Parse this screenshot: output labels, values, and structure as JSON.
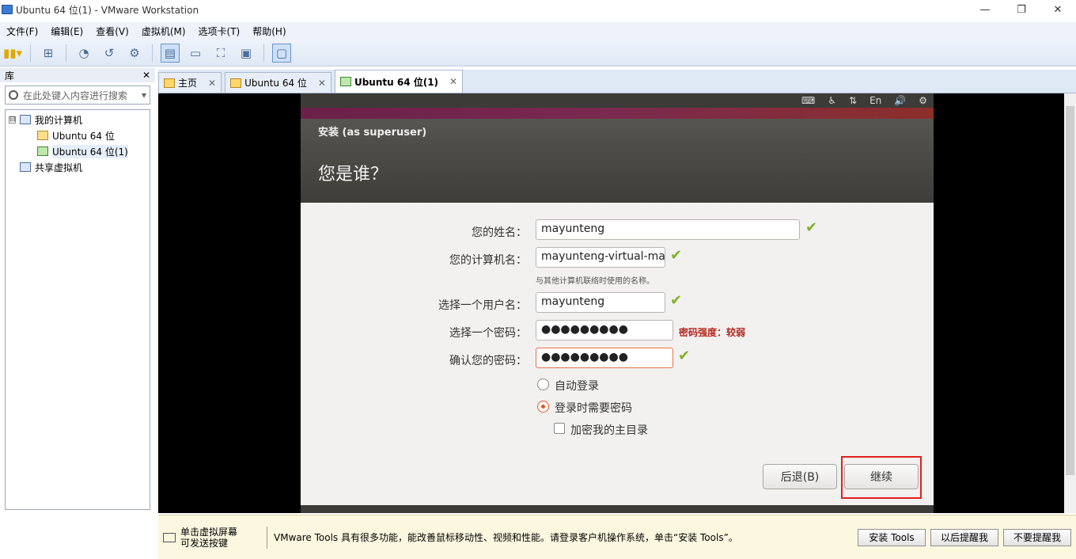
{
  "window": {
    "title": "Ubuntu 64 位(1) - VMware Workstation",
    "min": "—",
    "restore": "❐",
    "close": "✕"
  },
  "menu": [
    "文件(F)",
    "编辑(E)",
    "查看(V)",
    "虚拟机(M)",
    "选项卡(T)",
    "帮助(H)"
  ],
  "sidebar": {
    "title": "库",
    "close": "✕",
    "search_placeholder": "在此处键入内容进行搜索",
    "tree": {
      "root": "我的计算机",
      "vm1": "Ubuntu 64 位",
      "vm2": "Ubuntu 64 位(1)",
      "shared": "共享虚拟机",
      "collapse": "⊟"
    }
  },
  "tabs": [
    {
      "label": "主页"
    },
    {
      "label": "Ubuntu 64 位"
    },
    {
      "label": "Ubuntu 64 位(1)"
    }
  ],
  "tab_close": "✕",
  "guest": {
    "topbar": {
      "lang": "En"
    },
    "window_title": "安装 (as superuser)",
    "heading": "您是谁？",
    "form": {
      "name_label": "您的姓名：",
      "name_value": "mayunteng",
      "computer_label": "您的计算机名：",
      "computer_value": "mayunteng-virtual-ma",
      "computer_hint": "与其他计算机联络时使用的名称。",
      "user_label": "选择一个用户名：",
      "user_value": "mayunteng",
      "pw_label": "选择一个密码：",
      "pw_value": "●●●●●●●●●",
      "pw_strength": "密码强度：较弱",
      "pw2_label": "确认您的密码：",
      "pw2_value": "●●●●●●●●●",
      "auto_login": "自动登录",
      "require_pw": "登录时需要密码",
      "encrypt_home": "加密我的主目录",
      "check": "✔"
    },
    "buttons": {
      "back": "后退(B)",
      "continue": "继续"
    }
  },
  "notify": {
    "hint": "单击虚拟屏幕\n可发送按键",
    "message": "VMware Tools 具有很多功能，能改善鼠标移动性、视频和性能。请登录客户机操作系统，单击“安装 Tools”。",
    "install": "安装 Tools",
    "later": "以后提醒我",
    "never": "不要提醒我"
  }
}
